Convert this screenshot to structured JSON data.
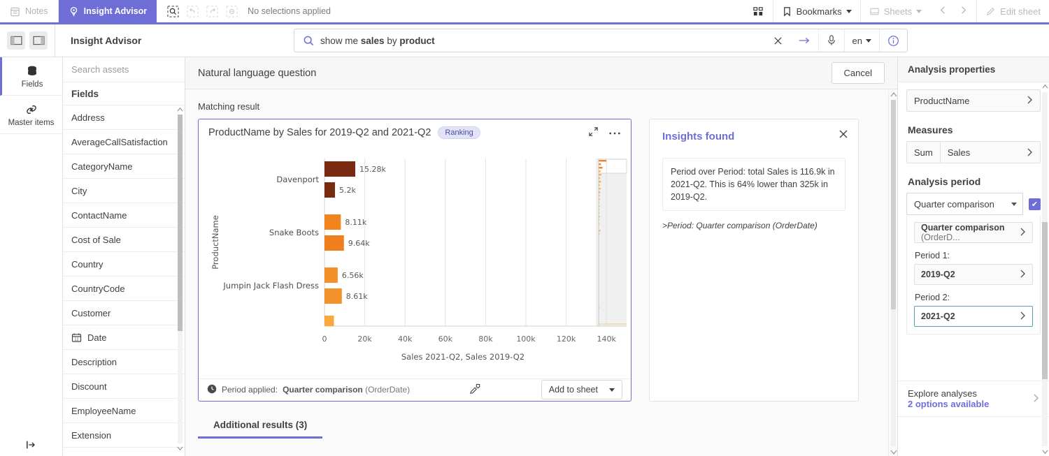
{
  "topbar": {
    "notes_label": "Notes",
    "insight_advisor_label": "Insight Advisor",
    "selection_status": "No selections applied",
    "bookmarks_label": "Bookmarks",
    "sheets_label": "Sheets",
    "edit_sheet_label": "Edit sheet",
    "accent": "#6e6ed6"
  },
  "secondbar": {
    "app_title": "Insight Advisor",
    "search_value_prefix": "show me ",
    "search_value_bold1": "sales",
    "search_value_mid": " by ",
    "search_value_bold2": "product",
    "search_full": "show me sales by product",
    "language": "en"
  },
  "rail": {
    "items": [
      {
        "label": "Fields",
        "icon": "database-icon",
        "active": true
      },
      {
        "label": "Master items",
        "icon": "link-icon",
        "active": false
      }
    ]
  },
  "assets": {
    "search_placeholder": "Search assets",
    "section_title": "Fields",
    "fields": [
      {
        "name": "Address",
        "icon": ""
      },
      {
        "name": "AverageCallSatisfaction",
        "icon": ""
      },
      {
        "name": "CategoryName",
        "icon": ""
      },
      {
        "name": "City",
        "icon": ""
      },
      {
        "name": "ContactName",
        "icon": ""
      },
      {
        "name": "Cost of Sale",
        "icon": ""
      },
      {
        "name": "Country",
        "icon": ""
      },
      {
        "name": "CountryCode",
        "icon": ""
      },
      {
        "name": "Customer",
        "icon": ""
      },
      {
        "name": "Date",
        "icon": "calendar-icon"
      },
      {
        "name": "Description",
        "icon": ""
      },
      {
        "name": "Discount",
        "icon": ""
      },
      {
        "name": "EmployeeName",
        "icon": ""
      },
      {
        "name": "Extension",
        "icon": ""
      }
    ]
  },
  "main": {
    "nlq_header": "Natural language question",
    "cancel_label": "Cancel",
    "matching_result_label": "Matching result",
    "additional_results_label": "Additional results (3)"
  },
  "card": {
    "title": "ProductName by Sales for 2019-Q2 and 2021-Q2",
    "badge": "Ranking",
    "footer_label": "Period applied:",
    "footer_value_bold": "Quarter comparison",
    "footer_value_rest": " (OrderDate)",
    "add_to_sheet_label": "Add to sheet"
  },
  "insights": {
    "title": "Insights found",
    "text": "Period over Period: total Sales is 116.9k in 2021-Q2. This is 64% lower than 325k in 2019-Q2.",
    "note": ">Period: Quarter comparison (OrderDate)"
  },
  "rightpanel": {
    "header": "Analysis properties",
    "dimension": "ProductName",
    "measures_label": "Measures",
    "measure_agg": "Sum",
    "measure_name": "Sales",
    "analysis_period_label": "Analysis period",
    "period_type": "Quarter comparison",
    "period_detail_bold": "Quarter comparison",
    "period_detail_rest": " (OrderD...",
    "period1_label": "Period 1:",
    "period1_value": "2019-Q2",
    "period2_label": "Period 2:",
    "period2_value": "2021-Q2",
    "explore_title": "Explore analyses",
    "explore_sub": "2 options available"
  },
  "chart_data": {
    "type": "bar",
    "orientation": "horizontal",
    "title": "ProductName by Sales for 2019-Q2 and 2021-Q2",
    "xlabel": "Sales 2021-Q2, Sales 2019-Q2",
    "ylabel": "ProductName",
    "xlim": [
      0,
      150000
    ],
    "xticks": [
      0,
      20000,
      40000,
      60000,
      80000,
      100000,
      120000,
      140000
    ],
    "xtick_labels": [
      "0",
      "20k",
      "40k",
      "60k",
      "80k",
      "100k",
      "120k",
      "140k"
    ],
    "grid": true,
    "legend": false,
    "categories": [
      "Davenport",
      "Snake Boots",
      "Jumpin Jack Flash Dress",
      ""
    ],
    "series": [
      {
        "name": "Sales 2021-Q2",
        "color": "#7a2a10",
        "values": [
          15280,
          8110,
          6560,
          5200
        ],
        "labels": [
          "15.28k",
          "8.11k",
          "6.56k",
          ""
        ]
      },
      {
        "name": "Sales 2019-Q2",
        "color": "#7a2a10",
        "values": [
          5200,
          9640,
          8610,
          0
        ],
        "labels": [
          "5.2k",
          "9.64k",
          "8.61k",
          ""
        ]
      }
    ],
    "bars": [
      {
        "category": "Davenport",
        "label": "15.28k",
        "value": 15280,
        "color": "#7a2a10",
        "row": 0
      },
      {
        "category": "Davenport",
        "label": "5.2k",
        "value": 5200,
        "color": "#7a2a10",
        "row": 1
      },
      {
        "category": "Snake Boots",
        "label": "8.11k",
        "value": 8110,
        "color": "#f0851f",
        "row": 2
      },
      {
        "category": "Snake Boots",
        "label": "9.64k",
        "value": 9640,
        "color": "#ef7e1f",
        "row": 3
      },
      {
        "category": "Jumpin Jack Flash Dress",
        "label": "6.56k",
        "value": 6560,
        "color": "#f39128",
        "row": 4
      },
      {
        "category": "Jumpin Jack Flash Dress",
        "label": "8.61k",
        "value": 8610,
        "color": "#f3922a",
        "row": 5
      },
      {
        "category": "",
        "label": "",
        "value": 4700,
        "color": "#f9a93a",
        "row": 6
      }
    ]
  }
}
